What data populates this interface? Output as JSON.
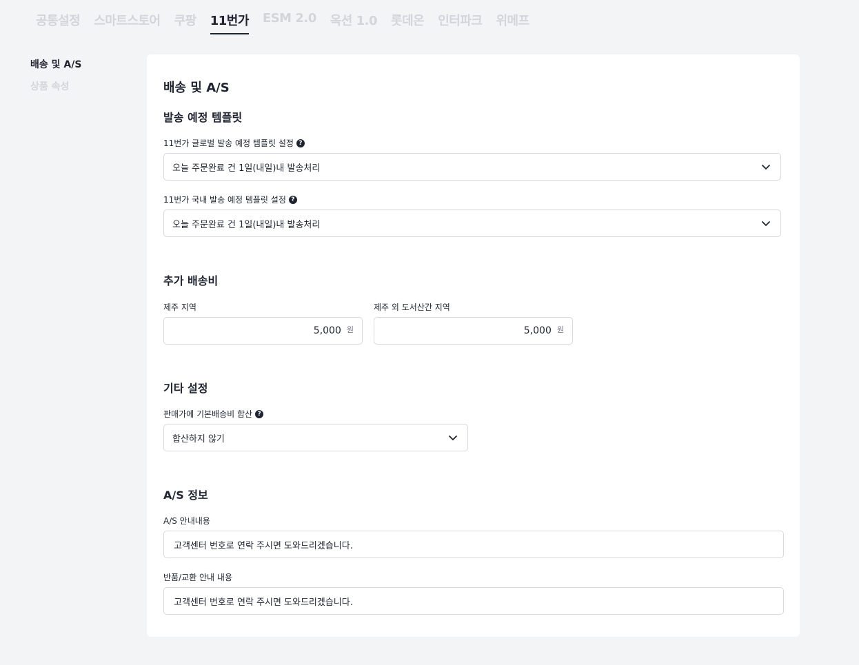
{
  "tabs": [
    {
      "label": "공통설정",
      "active": false
    },
    {
      "label": "스마트스토어",
      "active": false
    },
    {
      "label": "쿠팡",
      "active": false
    },
    {
      "label": "11번가",
      "active": true
    },
    {
      "label": "ESM 2.0",
      "active": false
    },
    {
      "label": "옥션 1.0",
      "active": false
    },
    {
      "label": "롯데온",
      "active": false
    },
    {
      "label": "인터파크",
      "active": false
    },
    {
      "label": "위메프",
      "active": false
    }
  ],
  "sidenav": {
    "items": [
      {
        "label": "배송 및 A/S",
        "active": true
      },
      {
        "label": "상품 속성",
        "active": false
      }
    ]
  },
  "page": {
    "title": "배송 및 A/S"
  },
  "shipping_template": {
    "title": "발송 예정 템플릿",
    "global_label": "11번가 글로벌 발송 예정 템플릿 설정",
    "global_value": "오늘 주문완료 건 1일(내일)내 발송처리",
    "domestic_label": "11번가 국내 발송 예정 템플릿 설정",
    "domestic_value": "오늘 주문완료 건 1일(내일)내 발송처리"
  },
  "extra_fee": {
    "title": "추가 배송비",
    "jeju_label": "제주 지역",
    "jeju_value": "5,000",
    "islands_label": "제주 외 도서산간 지역",
    "islands_value": "5,000",
    "unit": "원"
  },
  "etc": {
    "title": "기타 설정",
    "merge_label": "판매가에 기본배송비 합산",
    "merge_value": "합산하지 않기"
  },
  "as_info": {
    "title": "A/S 정보",
    "as_label": "A/S 안내내용",
    "as_value": "고객센터 번호로 연락 주시면 도와드리겠습니다.",
    "return_label": "반품/교환 안내 내용",
    "return_value": "고객센터 번호로 연락 주시면 도와드리겠습니다."
  },
  "icons": {
    "help": "question-circle-icon",
    "chevron": "chevron-down-icon"
  },
  "colors": {
    "background": "#f3f4f6",
    "text": "#1f2430",
    "inactive": "#d2d5da",
    "border": "#d6d9de"
  }
}
